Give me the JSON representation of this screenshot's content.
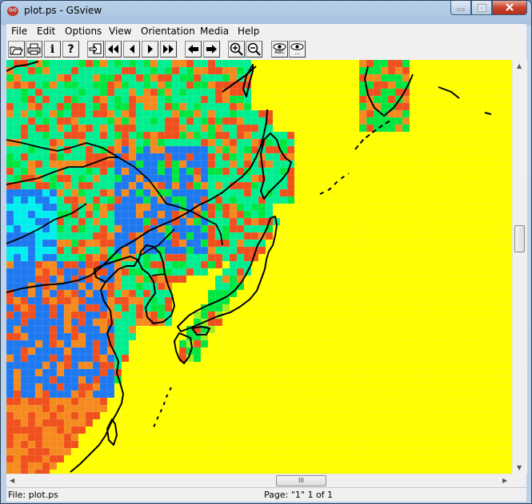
{
  "window": {
    "title": "plot.ps - GSview"
  },
  "menu": [
    "File",
    "Edit",
    "Options",
    "View",
    "Orientation",
    "Media",
    "Help"
  ],
  "toolbar": {
    "buttons": [
      "open-icon",
      "print-icon",
      "info-icon",
      "help-icon",
      "goto-page-icon",
      "first-page-icon",
      "prev-page-icon",
      "next-page-icon",
      "last-page-icon",
      "back-icon",
      "forward-icon",
      "zoom-in-icon",
      "zoom-out-icon",
      "find-text-icon",
      "find-next-icon"
    ],
    "info_glyph": "i",
    "help_glyph": "?",
    "find_label": "ABC",
    "find_next_label": "..."
  },
  "scrollbar": {
    "grip": "III"
  },
  "status": {
    "file": "File: plot.ps",
    "page": "Page: \"1\"  1 of 1"
  },
  "colors": {
    "background_field": "#ffff00",
    "orange": "#f58a1e",
    "red": "#f0501e",
    "green": "#00e640",
    "mint": "#00ee90",
    "blue": "#1e78f0",
    "cyan": "#00eeee",
    "lime": "#a0f020"
  }
}
